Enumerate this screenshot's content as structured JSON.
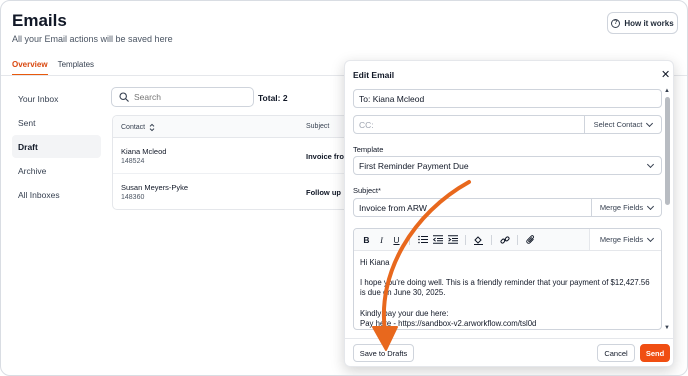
{
  "page": {
    "title": "Emails",
    "subtitle": "All your Email actions will be saved here",
    "help_button": "How it works"
  },
  "tabs": [
    {
      "label": "Overview",
      "active": true
    },
    {
      "label": "Templates",
      "active": false
    }
  ],
  "sidebar": {
    "items": [
      {
        "label": "Your Inbox",
        "active": false
      },
      {
        "label": "Sent",
        "active": false
      },
      {
        "label": "Draft",
        "active": true
      },
      {
        "label": "Archive",
        "active": false
      },
      {
        "label": "All Inboxes",
        "active": false
      }
    ]
  },
  "list": {
    "search_placeholder": "Search",
    "total": "Total: 2",
    "columns": {
      "contact": "Contact",
      "subject": "Subject"
    },
    "rows": [
      {
        "name": "Kiana Mcleod",
        "id": "148524",
        "subject": "Invoice from"
      },
      {
        "name": "Susan Meyers-Pyke",
        "id": "148360",
        "subject": "Follow up"
      }
    ]
  },
  "modal": {
    "title": "Edit Email",
    "to_value": "To: Kiana Mcleod",
    "cc_placeholder": "CC:",
    "select_contact": "Select Contact",
    "template_label": "Template",
    "template_value": "First Reminder Payment Due",
    "subject_label": "Subject*",
    "subject_value": "Invoice from ARW",
    "merge_fields": "Merge Fields",
    "editor_merge_fields": "Merge Fields",
    "body": {
      "greeting": "Hi Kiana",
      "p1": "I hope you're doing well. This is a friendly reminder that your payment of $12,427.56 is due on June 30, 2025.",
      "p2a": "Kindly pay your due here:",
      "p2b": " Pay here - https://sandbox-v2.arworkflow.com/tsl0d"
    },
    "save_drafts": "Save to Drafts",
    "cancel": "Cancel",
    "send": "Send"
  },
  "colors": {
    "accent": "#e8590c",
    "send_button": "#f04e12",
    "annotation_arrow": "#e8681d"
  }
}
